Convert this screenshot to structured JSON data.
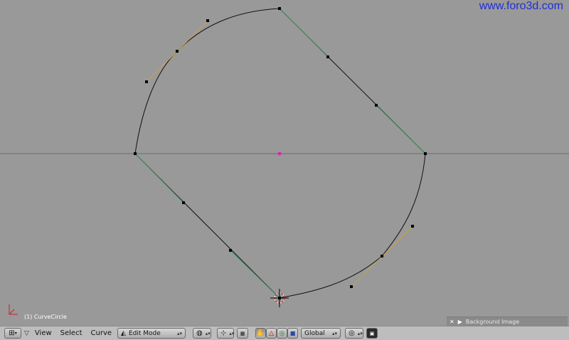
{
  "watermark": "www.foro3d.com",
  "viewport": {
    "object_label": "(1) CurveCircle",
    "background_panel": {
      "title": "Background Image",
      "close_icon": "x-icon",
      "expand_icon": "triangle-right-icon"
    }
  },
  "header": {
    "menus": [
      "View",
      "Select",
      "Curve"
    ],
    "mode": {
      "value": "Edit Mode",
      "icon": "edit-mode-icon"
    },
    "transform_orientation": {
      "value": "Global"
    },
    "icons": {
      "window_type": "grid-icon",
      "collapse": "triangle-down-icon",
      "draw_type": "draw-type-icon",
      "pivot": "pivot-icon",
      "manipulator_toggle": "manipulator-icon",
      "hand": "hand-icon",
      "translate": "translate-icon",
      "rotate": "rotate-icon",
      "scale": "scale-icon",
      "proportional": "proportional-icon",
      "render_icon": "render-icon"
    }
  },
  "colors": {
    "background": "#999999",
    "header": "#bdbdbd",
    "curve": "#111111",
    "handle_aligned": "#c9a23a",
    "handle_vector": "#3a9a58",
    "handle_free": "#222222",
    "center": "#d02fa0",
    "watermark": "#1f2fd6"
  }
}
